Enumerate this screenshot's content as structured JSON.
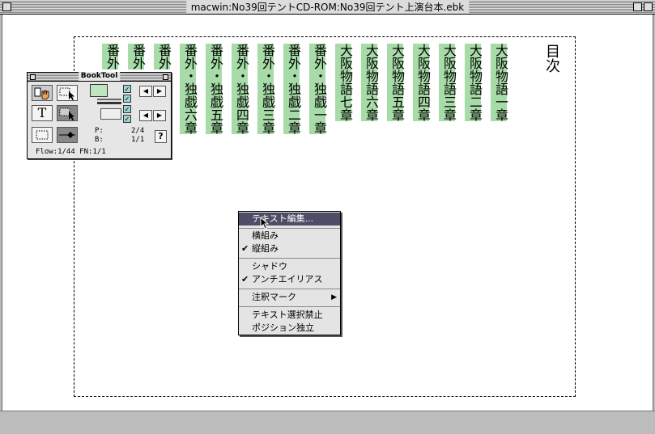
{
  "window": {
    "title": "macwin:No39回テントCD-ROM:No39回テント上演台本.ebk"
  },
  "document": {
    "toc": "目次",
    "columns": [
      "番外",
      "番外",
      "番外",
      "番外・独戯六章",
      "番外・独戯五章",
      "番外・独戯四章",
      "番外・独戯三章",
      "番外・独戯二章",
      "番外・独戯一章",
      "大阪物語七章",
      "大阪物語六章",
      "大阪物語五章",
      "大阪物語四章",
      "大阪物語三章",
      "大阪物語二章",
      "大阪物語一章"
    ]
  },
  "booktool": {
    "title": "BookTool",
    "text_tool": "T",
    "p_label": "P:",
    "p_value": "2/4",
    "b_label": "B:",
    "b_value": "1/1",
    "help": "?",
    "status": "Flow:1/44 FN:1/1"
  },
  "context_menu": {
    "items": [
      {
        "label": "テキスト編集...",
        "checked": false,
        "highlighted": true
      },
      {
        "label": "横組み",
        "checked": false
      },
      {
        "label": "縦組み",
        "checked": true
      },
      {
        "label": "シャドウ",
        "checked": false
      },
      {
        "label": "アンチエイリアス",
        "checked": true
      },
      {
        "label": "注釈マーク",
        "checked": false,
        "submenu": true
      },
      {
        "label": "テキスト選択禁止",
        "checked": false
      },
      {
        "label": "ポジション独立",
        "checked": false
      }
    ],
    "check_glyph": "✔",
    "submenu_glyph": "▶"
  },
  "colors": {
    "highlight": "#a7dba7",
    "menu_highlight": "#4d4d66"
  }
}
